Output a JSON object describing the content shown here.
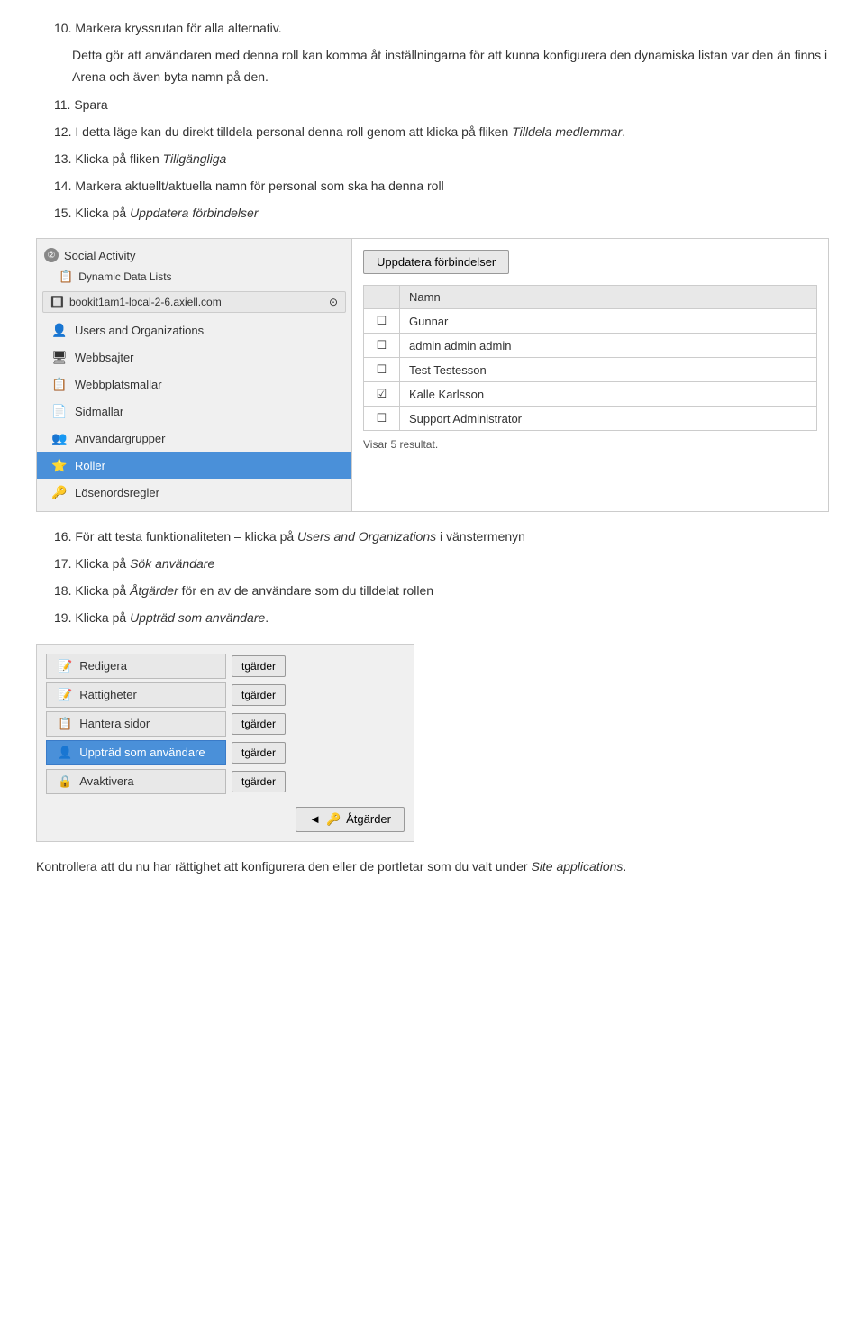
{
  "intro": {
    "item10": "10. Markera kryssrutan för alla alternativ.",
    "item10b": "Detta gör att användaren med denna roll kan komma åt inställningarna för att kunna konfigurera den dynamiska listan var den än finns i Arena och även byta namn på den.",
    "item11": "11. Spara",
    "item12_prefix": "12. I detta läge kan du direkt tilldela personal denna roll genom att klicka på fliken ",
    "item12_italic": "Tilldela medlemmar",
    "item12_suffix": ".",
    "item13_prefix": "13. Klicka på fliken ",
    "item13_italic": "Tillgängliga",
    "item14_prefix": "14. Markera aktuellt/aktuella namn för personal som ska ha denna roll",
    "item15_prefix": "15. Klicka på ",
    "item15_italic": "Uppdatera förbindelser"
  },
  "screenshot1": {
    "sidebar": {
      "header1_icon": "②",
      "header1_label": "Social Activity",
      "sub1_label": "Dynamic Data Lists",
      "site_label": "bookit1am1-local-2-6.axiell.com",
      "items": [
        {
          "id": "users",
          "label": "Users and Organizations",
          "icon": "👤"
        },
        {
          "id": "webbsajter",
          "label": "Webbsajter",
          "icon": "🖥"
        },
        {
          "id": "webbplatsmallar",
          "label": "Webbplatsmallar",
          "icon": "📋"
        },
        {
          "id": "sidmallar",
          "label": "Sidmallar",
          "icon": "📄"
        },
        {
          "id": "anvandargrupper",
          "label": "Användargrupper",
          "icon": "👥"
        },
        {
          "id": "roller",
          "label": "Roller",
          "icon": "⭐",
          "active": true
        },
        {
          "id": "losenordsregler",
          "label": "Lösenordsregler",
          "icon": "🔑"
        }
      ]
    },
    "main": {
      "update_btn": "Uppdatera förbindelser",
      "table": {
        "col_checkbox": "",
        "col_name": "Namn",
        "rows": [
          {
            "checked": false,
            "name": "Gunnar"
          },
          {
            "checked": false,
            "name": "admin admin admin"
          },
          {
            "checked": false,
            "name": "Test Testesson"
          },
          {
            "checked": true,
            "name": "Kalle Karlsson"
          },
          {
            "checked": false,
            "name": "Support Administrator"
          }
        ]
      },
      "result_text": "Visar 5 resultat."
    }
  },
  "step16_prefix": "16. För att testa funktionaliteten – klicka på ",
  "step16_italic": "Users and Organizations",
  "step16_suffix": " i vänstermenyn",
  "step17_prefix": "17. Klicka på ",
  "step17_italic": "Sök användare",
  "step18_prefix": "18. Klicka på ",
  "step18_italic": "Åtgärder",
  "step18_suffix": " för en av de användare som du tilldelat rollen",
  "step19_prefix": "19. Klicka på ",
  "step19_italic": "Uppträd som användare",
  "step19_suffix": ".",
  "screenshot2": {
    "menu_items": [
      {
        "id": "redigera",
        "label": "Redigera",
        "icon": "📝",
        "highlight": false,
        "btn": "tgärder"
      },
      {
        "id": "rattigheter",
        "label": "Rättigheter",
        "icon": "📝",
        "highlight": false,
        "btn": "tgärder"
      },
      {
        "id": "hantera",
        "label": "Hantera sidor",
        "icon": "📋",
        "highlight": false,
        "btn": "tgärder"
      },
      {
        "id": "upptratt",
        "label": "Uppträd som användare",
        "icon": "👤",
        "highlight": true,
        "btn": "tgärder"
      },
      {
        "id": "avaktivera",
        "label": "Avaktivera",
        "icon": "🔒",
        "highlight": false,
        "btn": "tgärder"
      }
    ],
    "main_btn_icon": "◄",
    "main_btn_icon2": "🔑",
    "main_btn_label": "Åtgärder"
  },
  "footer": {
    "text1": "Kontrollera att du nu har rättighet att konfigurera den eller de portletar som du valt under ",
    "text2_italic": "Site applications",
    "text2_suffix": "."
  }
}
